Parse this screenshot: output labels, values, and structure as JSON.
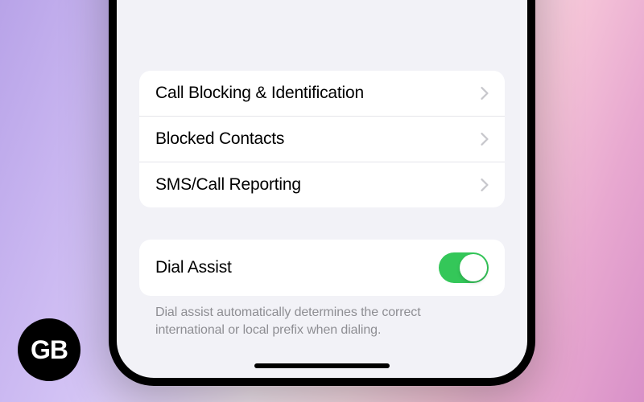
{
  "settings": {
    "group1": {
      "items": [
        {
          "label": "Call Blocking & Identification"
        },
        {
          "label": "Blocked Contacts"
        },
        {
          "label": "SMS/Call Reporting"
        }
      ]
    },
    "group2": {
      "toggle": {
        "label": "Dial Assist",
        "on": true
      },
      "footer": "Dial assist automatically determines the correct international or local prefix when dialing."
    }
  },
  "badge": {
    "text": "GB"
  },
  "colors": {
    "toggle_on": "#34c759",
    "bg_grouped": "#f2f2f7",
    "chevron": "#c7c7cc",
    "footer": "#8e8e93"
  }
}
